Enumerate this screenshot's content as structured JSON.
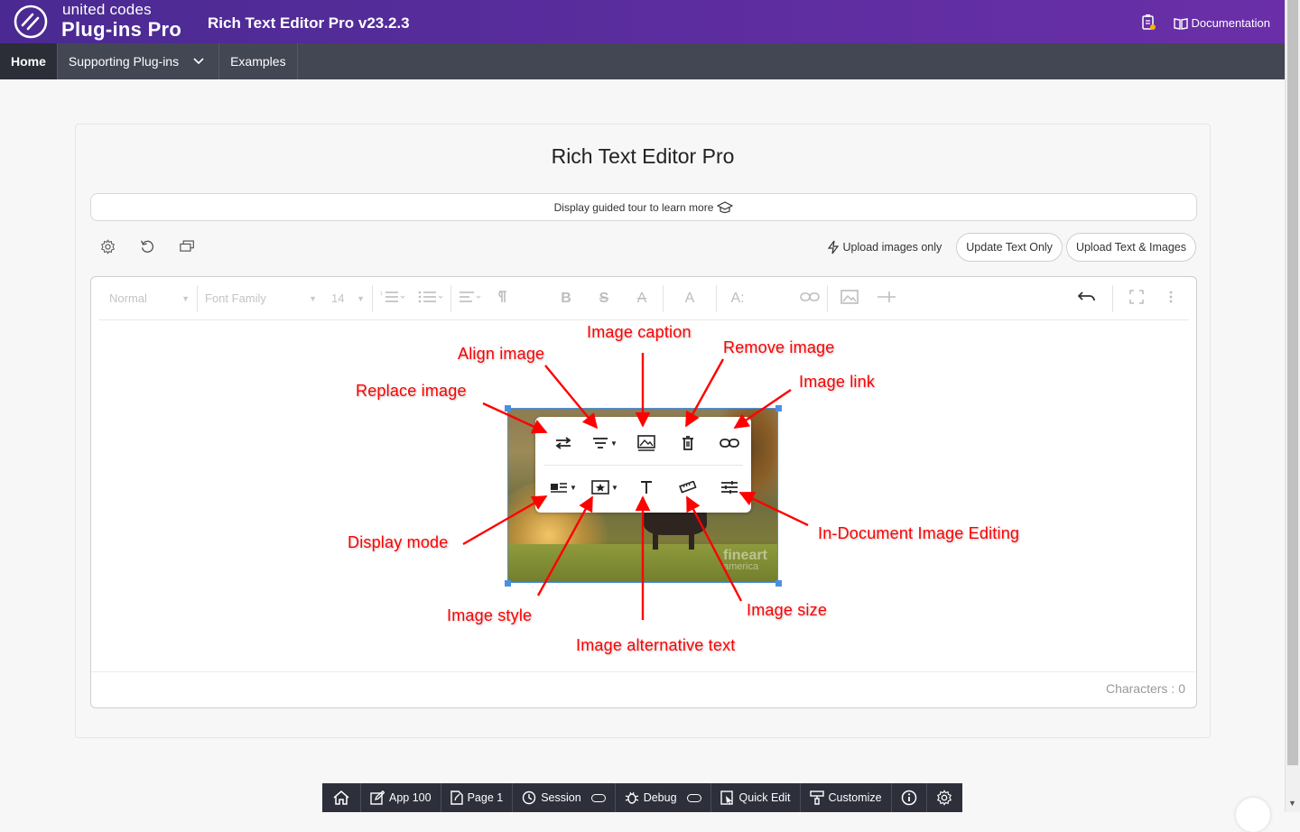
{
  "header": {
    "brand_small": "united codes",
    "brand_big": "Plug-ins Pro",
    "title": "Rich Text Editor Pro v23.2.3",
    "documentation_label": "Documentation",
    "notes_icon": "clipboard-icon"
  },
  "nav": {
    "items": [
      {
        "label": "Home",
        "active": true
      },
      {
        "label": "Supporting Plug-ins",
        "has_dropdown": true
      },
      {
        "label": "Examples"
      }
    ]
  },
  "card": {
    "title": "Rich Text Editor Pro",
    "tour_label": "Display guided tour to learn more",
    "left_tools": [
      "gear-icon",
      "reset-icon",
      "windows-icon"
    ],
    "upload_images_label": "Upload images only",
    "update_text_label": "Update Text Only",
    "upload_text_images_label": "Upload Text & Images"
  },
  "editor": {
    "toolbar": {
      "heading_value": "Normal",
      "font_family_value": "Font Family",
      "font_size_value": "14",
      "bold_glyph": "B",
      "strike_glyph": "S",
      "clear_glyph": "A",
      "font_color_glyph": "A",
      "font_size_glyph": "A:"
    },
    "characters_label": "Characters :",
    "characters_value": "0"
  },
  "image_balloon": {
    "row1": [
      "swap-arrows-icon",
      "align-icon",
      "image-caption-icon",
      "trash-icon",
      "link-icon"
    ],
    "row2": [
      "display-mode-icon",
      "image-style-icon",
      "text-t-icon",
      "ruler-icon",
      "sliders-icon"
    ],
    "watermark_line1": "fineart",
    "watermark_line2": "america"
  },
  "annotations": {
    "replace_image": "Replace image",
    "align_image": "Align image",
    "image_caption": "Image caption",
    "remove_image": "Remove image",
    "image_link": "Image link",
    "display_mode": "Display mode",
    "image_style": "Image style",
    "image_alt_text": "Image alternative text",
    "image_size": "Image size",
    "in_document_editing": "In-Document Image Editing"
  },
  "apex_toolbar": {
    "items": [
      {
        "label": "",
        "icon": "home-icon"
      },
      {
        "label": "App 100",
        "icon": "edit-icon"
      },
      {
        "label": "Page 1",
        "icon": "page-edit-icon"
      },
      {
        "label": "Session",
        "icon": "session-icon"
      },
      {
        "label": "Debug",
        "icon": "bug-icon"
      },
      {
        "label": "Quick Edit",
        "icon": "quick-edit-icon"
      },
      {
        "label": "Customize",
        "icon": "brush-icon"
      },
      {
        "label": "",
        "icon": "info-icon"
      },
      {
        "label": "",
        "icon": "gear-icon"
      }
    ]
  },
  "colors": {
    "header_gradient_start": "#4a2a92",
    "header_gradient_end": "#6a2fa8",
    "nav_bg": "#434653",
    "annotation_red": "#ff0000",
    "selection_blue": "#4a90e2",
    "apex_bar": "#2d2f3a"
  }
}
